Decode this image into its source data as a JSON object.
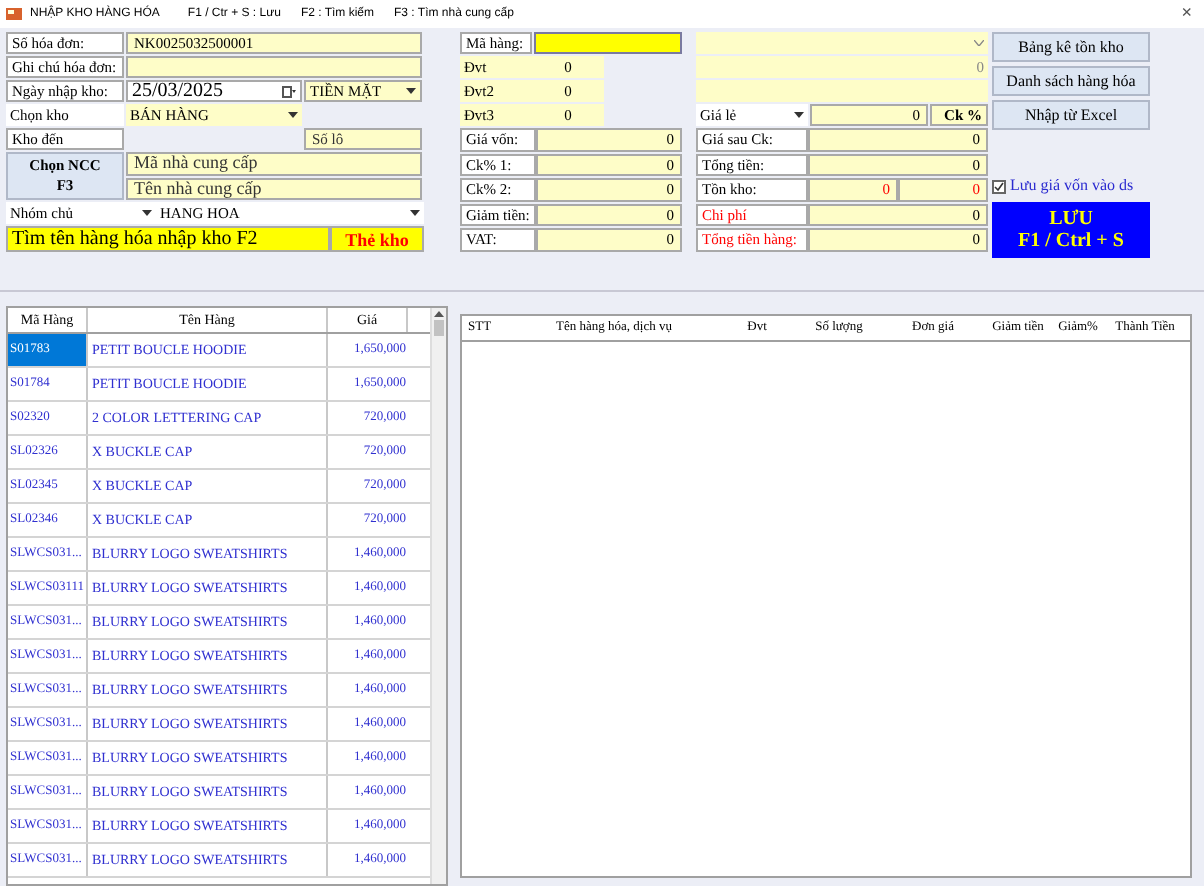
{
  "title_bar": {
    "title": "NHẬP KHO HÀNG HÓA",
    "shortcuts": [
      "F1 / Ctr + S : Lưu",
      "F2 : Tìm kiếm",
      "F3 : Tìm nhà cung cấp"
    ],
    "close": "×"
  },
  "header_form": {
    "invoice_no": {
      "label": "Số hóa đơn:",
      "value": "NK0025032500001"
    },
    "note": {
      "label": "Ghi chú hóa đơn:"
    },
    "date": {
      "label": "Ngày nhập kho:",
      "value": "25/03/2025"
    },
    "payment": {
      "value": "TIỀN MẶT"
    },
    "warehouse": {
      "label": "Chọn kho",
      "value": "BÁN HÀNG"
    },
    "to_warehouse": {
      "label": "Kho đến"
    },
    "lot": {
      "placeholder": "Số lô"
    },
    "supplier_button": {
      "lines": [
        "Chọn NCC",
        "F3"
      ]
    },
    "supplier_code": {
      "placeholder": "Mã nhà cung cấp"
    },
    "supplier_name": {
      "placeholder": "Tên nhà cung cấp"
    },
    "group": {
      "label": "Nhóm chủ",
      "value": "HANG HOA"
    },
    "search_bar": {
      "label": "Tìm tên hàng hóa nhập kho F2"
    },
    "stock_card_button": {
      "label": "Thẻ kho"
    }
  },
  "item_form": {
    "code_label": "Mã hàng:",
    "units": [
      {
        "label": "Đvt",
        "value": "0"
      },
      {
        "label": "Đvt2",
        "value": "0"
      },
      {
        "label": "Đvt3",
        "value": "0"
      }
    ],
    "costs": [
      {
        "label": "Giá vốn:",
        "value": "0"
      },
      {
        "label": "Ck% 1:",
        "value": "0"
      },
      {
        "label": "Ck% 2:",
        "value": "0"
      },
      {
        "label": "Giảm tiền:",
        "value": "0"
      },
      {
        "label": "VAT:",
        "value": "0"
      }
    ],
    "amount": "0",
    "price_type": "Giá lẻ",
    "price": "0",
    "discount_label": "Ck %",
    "totals": [
      {
        "kind": "normal",
        "label": "Giá sau Ck:",
        "values": [
          "0"
        ]
      },
      {
        "kind": "normal",
        "label": "Tổng tiền:",
        "values": [
          "0"
        ]
      },
      {
        "kind": "stock",
        "label": "Tồn kho:",
        "values": [
          "0",
          "0"
        ]
      },
      {
        "kind": "alert",
        "label": "Chi phí",
        "values": [
          "0"
        ]
      },
      {
        "kind": "alert",
        "label": "Tổng tiền hàng:",
        "values": [
          "0"
        ]
      }
    ]
  },
  "buttons": [
    "Bảng kê tồn kho",
    "Danh sách hàng hóa",
    "Nhập từ Excel"
  ],
  "save_cost_checkbox": {
    "label": "Lưu giá vốn vào ds",
    "checked": true
  },
  "save_button": {
    "lines": [
      "LƯU",
      "F1 / Ctrl + S"
    ]
  },
  "product_table": {
    "columns": [
      "Mã Hàng",
      "Tên Hàng",
      "Giá"
    ],
    "rows": [
      {
        "code": "S01783",
        "name": "PETIT BOUCLE HOODIE",
        "price": "1,650,000",
        "selected": true
      },
      {
        "code": "S01784",
        "name": "PETIT BOUCLE HOODIE",
        "price": "1,650,000",
        "selected": false
      },
      {
        "code": "S02320",
        "name": "2 COLOR LETTERING CAP",
        "price": "720,000",
        "selected": false
      },
      {
        "code": "SL02326",
        "name": "X BUCKLE CAP",
        "price": "720,000",
        "selected": false
      },
      {
        "code": "SL02345",
        "name": "X BUCKLE CAP",
        "price": "720,000",
        "selected": false
      },
      {
        "code": "SL02346",
        "name": "X BUCKLE CAP",
        "price": "720,000",
        "selected": false
      },
      {
        "code": "SLWCS031...",
        "name": "BLURRY LOGO SWEATSHIRTS",
        "price": "1,460,000",
        "selected": false
      },
      {
        "code": "SLWCS03111",
        "name": "BLURRY LOGO SWEATSHIRTS",
        "price": "1,460,000",
        "selected": false
      },
      {
        "code": "SLWCS031...",
        "name": "BLURRY LOGO SWEATSHIRTS",
        "price": "1,460,000",
        "selected": false
      },
      {
        "code": "SLWCS031...",
        "name": "BLURRY LOGO SWEATSHIRTS",
        "price": "1,460,000",
        "selected": false
      },
      {
        "code": "SLWCS031...",
        "name": "BLURRY LOGO SWEATSHIRTS",
        "price": "1,460,000",
        "selected": false
      },
      {
        "code": "SLWCS031...",
        "name": "BLURRY LOGO SWEATSHIRTS",
        "price": "1,460,000",
        "selected": false
      },
      {
        "code": "SLWCS031...",
        "name": "BLURRY LOGO SWEATSHIRTS",
        "price": "1,460,000",
        "selected": false
      },
      {
        "code": "SLWCS031...",
        "name": "BLURRY LOGO SWEATSHIRTS",
        "price": "1,460,000",
        "selected": false
      },
      {
        "code": "SLWCS031...",
        "name": "BLURRY LOGO SWEATSHIRTS",
        "price": "1,460,000",
        "selected": false
      },
      {
        "code": "SLWCS031...",
        "name": "BLURRY LOGO SWEATSHIRTS",
        "price": "1,460,000",
        "selected": false
      }
    ]
  },
  "line_table": {
    "columns": [
      "STT",
      "Tên hàng hóa, dịch vụ",
      "Đvt",
      "Số lượng",
      "Đơn giá",
      "Giảm tiền",
      "Giảm%",
      "Thành Tiền"
    ]
  }
}
